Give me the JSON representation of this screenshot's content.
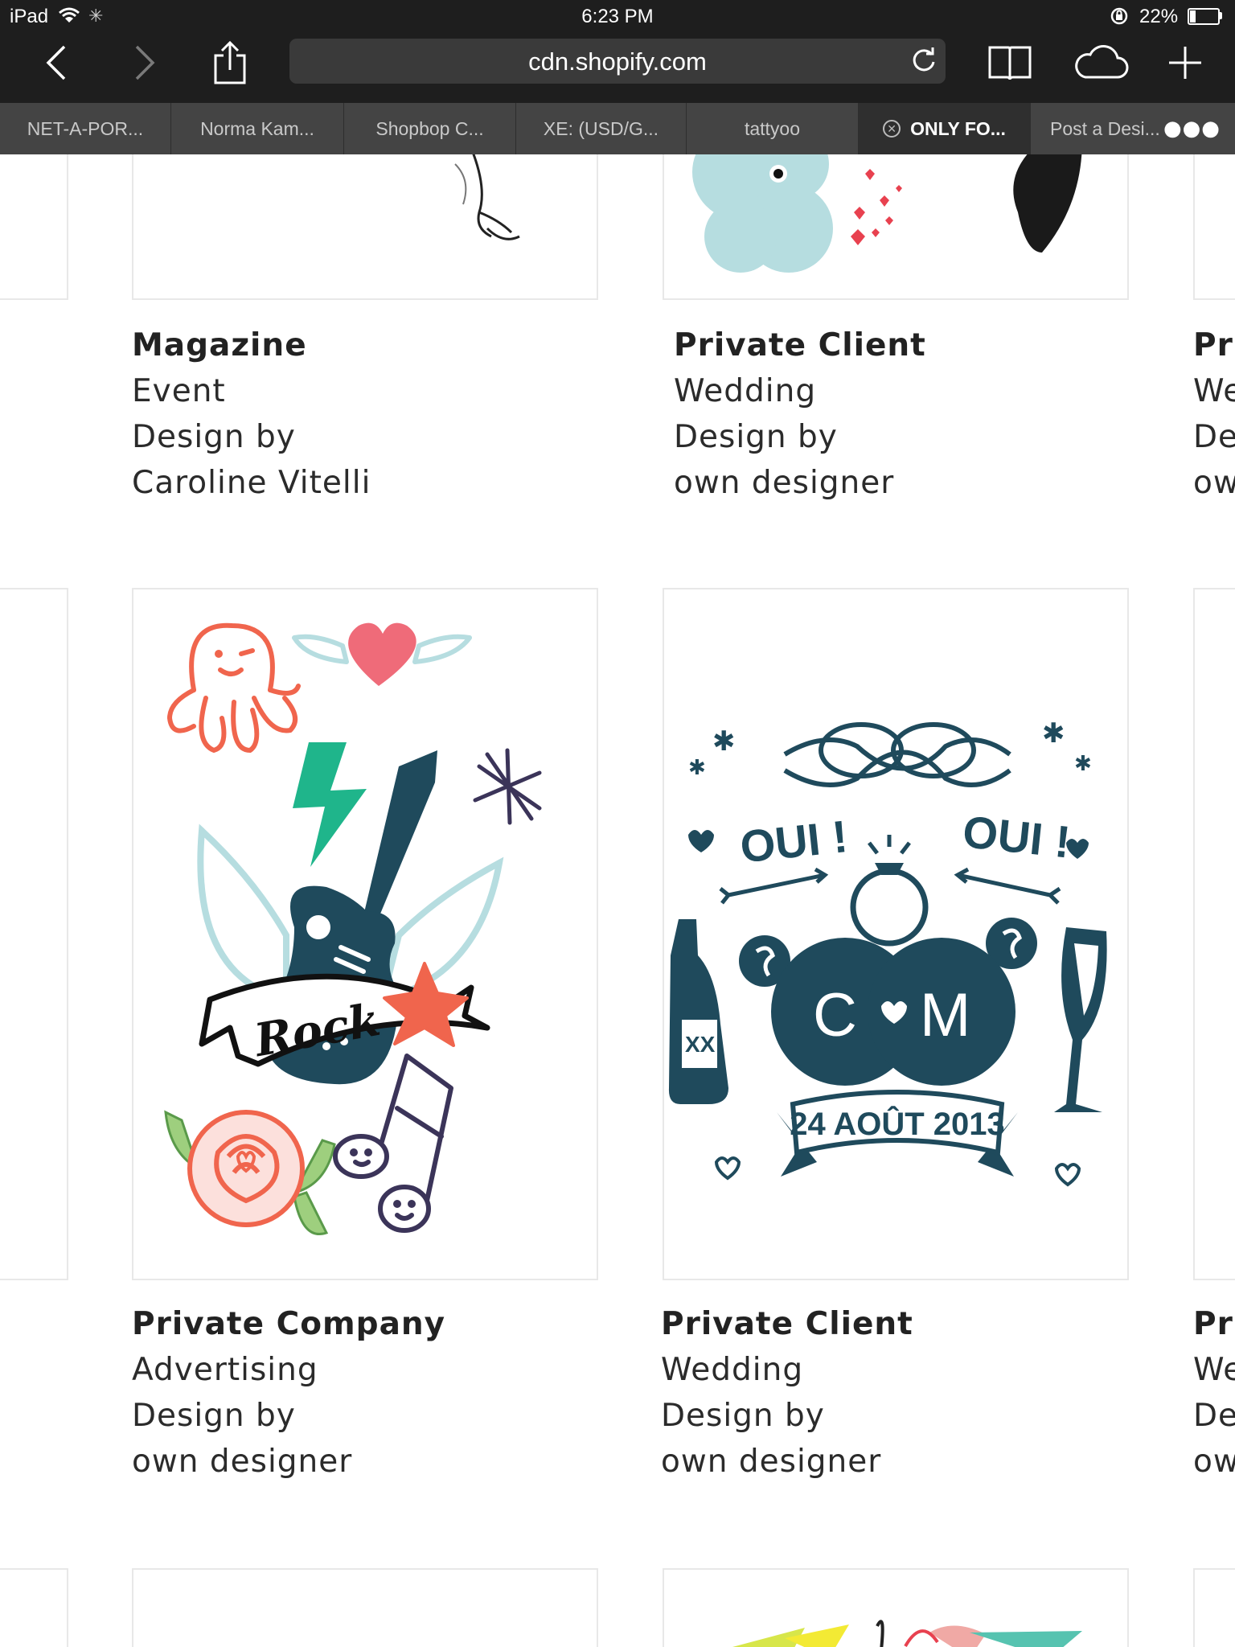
{
  "status_bar": {
    "device": "iPad",
    "time": "6:23 PM",
    "battery_percent": "22%",
    "battery_level": 0.22
  },
  "toolbar": {
    "url": "cdn.shopify.com"
  },
  "tabs": [
    {
      "label": "NET-A-POR..."
    },
    {
      "label": "Norma Kam..."
    },
    {
      "label": "Shopbop C..."
    },
    {
      "label": "XE: (USD/G..."
    },
    {
      "label": "tattyoo"
    },
    {
      "label": "ONLY FO...",
      "active": true
    },
    {
      "label": "Post a Desi..."
    }
  ],
  "cards": [
    {
      "client": "Magazine",
      "type": "Event",
      "design_by": "Design by",
      "designer": "Caroline Vitelli"
    },
    {
      "client": "Private Client",
      "type": "Wedding",
      "design_by": "Design by",
      "designer": "own designer"
    },
    {
      "client": "Pri",
      "type": "We",
      "design_by": "De",
      "designer": "ow"
    },
    {
      "client": "Private Company",
      "type": "Advertising",
      "design_by": "Design by",
      "designer": "own designer"
    },
    {
      "client": "Private Client",
      "type": "Wedding",
      "design_by": "Design by",
      "designer": "own designer"
    },
    {
      "client": "Pri",
      "type": "We",
      "design_by": "De",
      "designer": "ow"
    }
  ],
  "artwork": {
    "rock_banner": "Rock",
    "oui_left": "OUI !",
    "oui_right": "OUI !",
    "initial_c": "C",
    "initial_m": "M",
    "wedding_date": "24 AOÛT 2013",
    "bottle_label": "XX"
  },
  "colors": {
    "chrome": "#1e1e1e",
    "tab_strip": "#444444",
    "navy": "#1f4a5c",
    "coral": "#f0654d",
    "pink": "#ef6b79",
    "mint": "#1fb58b",
    "light_blue": "#b6dde0",
    "purple": "#3b3459"
  }
}
